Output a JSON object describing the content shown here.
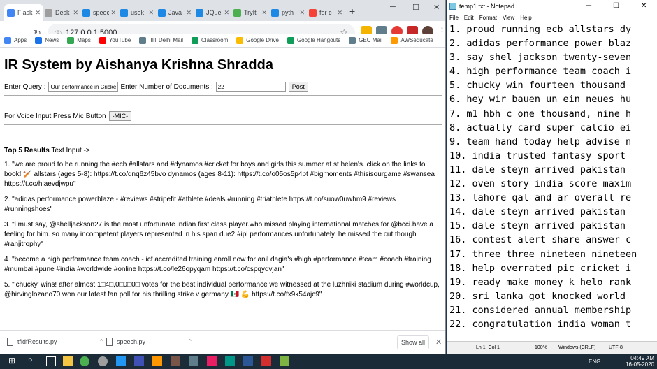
{
  "browser": {
    "tabs": [
      {
        "label": "Flask",
        "color": "#4285f4",
        "active": true
      },
      {
        "label": "Desk",
        "color": "#9e9e9e",
        "active": false
      },
      {
        "label": "speech",
        "color": "#1e88e5",
        "active": false
      },
      {
        "label": "usek",
        "color": "#1e88e5",
        "active": false
      },
      {
        "label": "Java",
        "color": "#1e88e5",
        "active": false
      },
      {
        "label": "JQue",
        "color": "#1e88e5",
        "active": false
      },
      {
        "label": "TryIt",
        "color": "#4caf50",
        "active": false
      },
      {
        "label": "pyth",
        "color": "#1e88e5",
        "active": false
      },
      {
        "label": "for c",
        "color": "#f44336",
        "active": false
      }
    ],
    "url": "127.0.0.1:5000",
    "bookmarks": [
      {
        "label": "Apps",
        "color": "#4285f4"
      },
      {
        "label": "News",
        "color": "#1a73e8"
      },
      {
        "label": "Maps",
        "color": "#34a853"
      },
      {
        "label": "YouTube",
        "color": "#ff0000"
      },
      {
        "label": "IIIT Delhi Mail",
        "color": "#607d8b"
      },
      {
        "label": "Classroom",
        "color": "#0f9d58"
      },
      {
        "label": "Google Drive",
        "color": "#fbbc04"
      },
      {
        "label": "Google Hangouts",
        "color": "#0f9d58"
      },
      {
        "label": "GEU Mail",
        "color": "#607d8b"
      },
      {
        "label": "AWSeducate",
        "color": "#ff9900"
      }
    ]
  },
  "page": {
    "title": "IR System by Aishanya Krishna Shradda",
    "query_label": "Enter Query :",
    "query_value": "Our performance in Cricket",
    "docs_label": "Enter Number of Documents :",
    "docs_value": "22",
    "post_label": "Post",
    "voice_label": "For Voice Input Press Mic Button",
    "mic_label": "-MIC-",
    "results_heading": "Top 5 Results",
    "results_suffix": " Text Input ->",
    "results": [
      "1. \"we are proud to be running the #ecb #allstars and #dynamos #cricket for boys and girls this summer at st helen's. click on the links to book! 🏏 allstars (ages 5-8): https://t.co/qnq6z45bvo dynamos (ages 8-11): https://t.co/o05os5p4pt #bigmoments #thisisourgame #swansea https://t.co/hiaevdjwpu\"",
      "2. \"adidas performance powerblaze - #reviews #stripefit #athlete #deals #running #triathlete https://t.co/suow0uwhm9 #reviews #runningshoes\"",
      "3. \"i must say, @shelljackson27 is the most unfortunate indian first class player.who missed playing international matches for @bcci.have a feeling for him. so many incompetent players represented in his span due2 #ipl performances unfortunately. he missed the cut though #ranjitrophy\"",
      "4. \"become a high performance team coach - icf accredited training enroll now for anil dagia's #high #performance #team #coach #training #mumbai #pune #india #worldwide #online https://t.co/le26opyqam https://t.co/cspqydvjan\"",
      "5. \"'chucky' wins! after almost 1□4□,0□0□0□ votes for the best individual performance we witnessed at the luzhniki stadium during #worldcup, @hirvinglozano70 won our latest fan poll for his thrilling strike v germany 🇲🇽 💪 https://t.co/fx9k54ajc9\""
    ]
  },
  "downloads": {
    "items": [
      "tfidfResults.py",
      "speech.py"
    ],
    "show_all": "Show all"
  },
  "notepad": {
    "title": "temp1.txt - Notepad",
    "menu": [
      "File",
      "Edit",
      "Format",
      "View",
      "Help"
    ],
    "lines": [
      "1. proud running ecb allstars dy",
      "2. adidas performance power blaz",
      "3. say shel jackson twenty-seven",
      "4. high performance team coach i",
      "5. chucky win fourteen thousand ",
      "6. hey wir bauen un ein neues hu",
      "7. m1 hbh c one thousand, nine h",
      "8. actually card super calcio ei",
      "9. team hand today help advise n",
      "10. india trusted fantasy sport ",
      "11. dale steyn arrived pakistan ",
      "12. oven story india score maxim",
      "13. lahore qal and ar overall re",
      "14. dale steyn arrived pakistan ",
      "15. dale steyn arrived pakistan ",
      "16. contest alert share answer c",
      "17. three three nineteen nineteen",
      "18. help overrated pic cricket i",
      "19. ready make money k helo rank",
      "20. sri lanka got knocked world ",
      "21. considered annual membership",
      "22. congratulation india woman t"
    ],
    "status": {
      "position": "Ln 1, Col 1",
      "zoom": "100%",
      "line_ending": "Windows (CRLF)",
      "encoding": "UTF-8"
    }
  },
  "taskbar": {
    "lang": "ENG",
    "time": "04:49 AM",
    "date": "16-05-2020"
  }
}
